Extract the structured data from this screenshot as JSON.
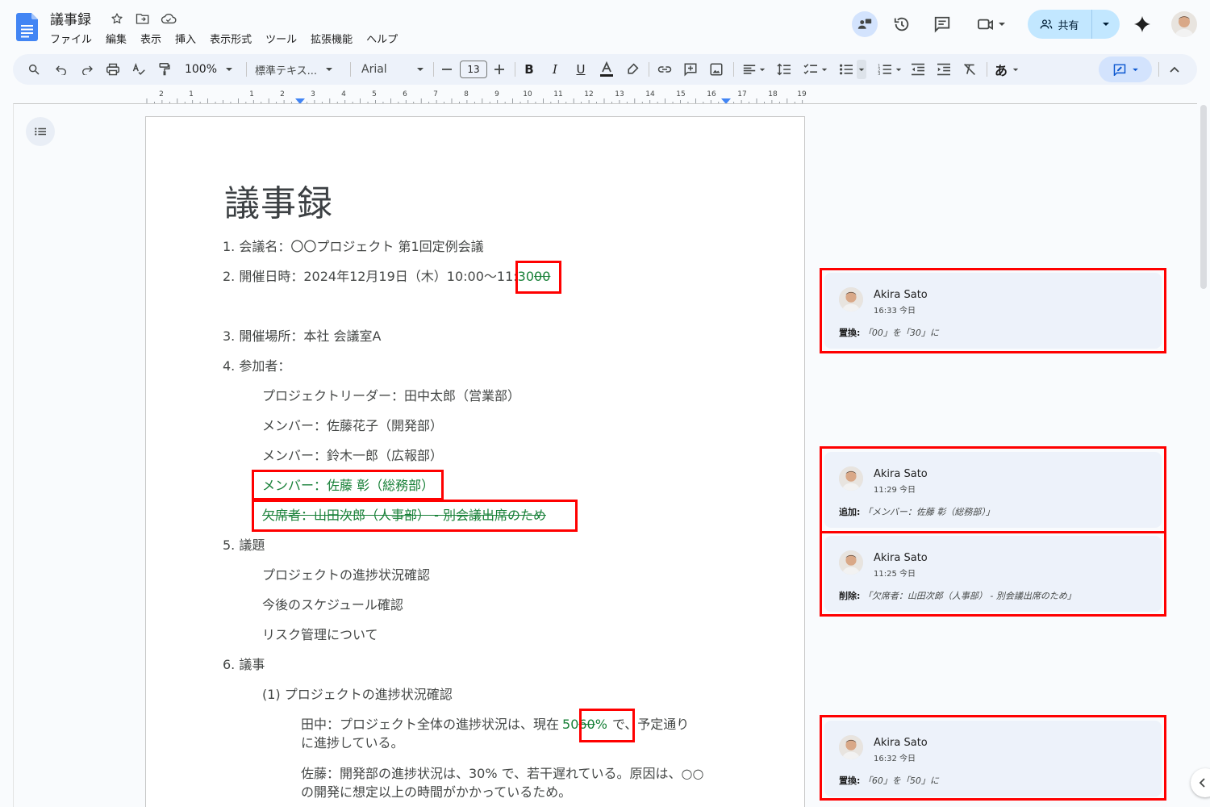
{
  "app": {
    "title": "議事録",
    "menus": [
      "ファイル",
      "編集",
      "表示",
      "挿入",
      "表示形式",
      "ツール",
      "拡張機能",
      "ヘルプ"
    ],
    "share_label": "共有"
  },
  "toolbar": {
    "zoom": "100%",
    "style": "標準テキス...",
    "font": "Arial",
    "font_size": "13",
    "input_tool": "あ"
  },
  "ruler": {
    "labels": [
      "2",
      "1",
      "1",
      "2",
      "3",
      "4",
      "5",
      "6",
      "7",
      "8",
      "9",
      "10",
      "11",
      "12",
      "13",
      "14",
      "15",
      "16",
      "17",
      "18",
      "19"
    ]
  },
  "document": {
    "heading": "議事録",
    "item1": "1. 会議名：〇〇プロジェクト 第1回定例会議",
    "item2_prefix": "2. 開催日時：2024年12月19日（木）10:00〜11:",
    "item2_ins": "30",
    "item2_del": "00",
    "item3": "3. 開催場所：本社 会議室A",
    "item4": "4. 参加者：",
    "att1": "プロジェクトリーダー：田中太郎（営業部）",
    "att2": "メンバー：佐藤花子（開発部）",
    "att3": "メンバー：鈴木一郎（広報部）",
    "att4_ins": "メンバー：佐藤 彰（総務部）",
    "att5_del": "欠席者：山田次郎（人事部） - 別会議出席のため",
    "item5": "5. 議題",
    "agenda1": "プロジェクトの進捗状況確認",
    "agenda2": "今後のスケジュール確認",
    "agenda3": "リスク管理について",
    "item6": "6. 議事",
    "sub1": "(1) プロジェクトの進捗状況確認",
    "tanaka_prefix": "田中：プロジェクト全体の進捗状況は、現在",
    "tanaka_ins": "50",
    "tanaka_del": "60",
    "tanaka_suffix": "%",
    "tanaka_rest": "で、予定通り",
    "tanaka_line2": "に進捗している。",
    "sato_line1": "佐藤：開発部の進捗状況は、30% で、若干遅れている。原因は、○○",
    "sato_line2": "の開発に想定以上の時間がかかっているため。"
  },
  "suggestions": [
    {
      "author": "Akira Sato",
      "time": "16:33 今日",
      "action": "置換:",
      "detail": "「00」を「30」に"
    },
    {
      "author": "Akira Sato",
      "time": "11:29 今日",
      "action": "追加:",
      "detail": "「メンバー：佐藤 彰（総務部）」"
    },
    {
      "author": "Akira Sato",
      "time": "11:25 今日",
      "action": "削除:",
      "detail": "「欠席者：山田次郎（人事部） - 別会議出席のため」"
    },
    {
      "author": "Akira Sato",
      "time": "16:32 今日",
      "action": "置換:",
      "detail": "「60」を「50」に"
    }
  ]
}
